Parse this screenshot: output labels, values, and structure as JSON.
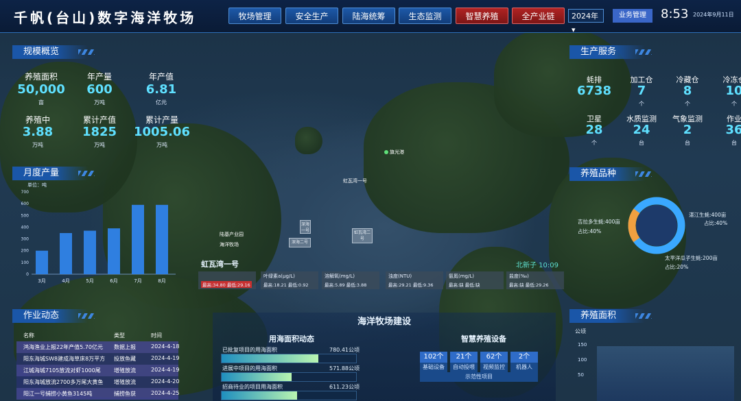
{
  "header": {
    "title": "千帆(台山)数字海洋牧场",
    "nav": [
      "牧场管理",
      "安全生产",
      "陆海统筹",
      "生态监测",
      "智慧养殖",
      "全产业链"
    ],
    "year": "2024年",
    "biz": "业务管理",
    "time": "8:53",
    "date": "2024年9月11日"
  },
  "scale": {
    "title": "规模概览",
    "items": [
      {
        "label": "养殖面积",
        "value": "50,000",
        "unit": "亩"
      },
      {
        "label": "年产量",
        "value": "600",
        "unit": "万吨"
      },
      {
        "label": "年产值",
        "value": "6.81",
        "unit": "亿元"
      },
      {
        "label": "养殖中",
        "value": "3.88",
        "unit": "万吨"
      },
      {
        "label": "累计产值",
        "value": "1825",
        "unit": "万吨"
      },
      {
        "label": "累计产量",
        "value": "1005.06",
        "unit": "万吨"
      }
    ]
  },
  "monthly": {
    "title": "月度产量",
    "ylabel": "单位：吨"
  },
  "chart_data": {
    "type": "bar",
    "categories": [
      "3月",
      "4月",
      "5月",
      "6月",
      "7月",
      "8月"
    ],
    "values": [
      200,
      350,
      370,
      390,
      590,
      590
    ],
    "yticks": [
      "0",
      "100",
      "200",
      "300",
      "400",
      "500",
      "600",
      "700"
    ],
    "ylim": [
      0,
      700
    ]
  },
  "activity": {
    "title": "作业动态",
    "headers": [
      "名称",
      "类型",
      "时间"
    ],
    "rows": [
      [
        "鸿海渔业上报22年产值5.70亿元",
        "数据上报",
        "2024-4-18"
      ],
      [
        "阳东海城SW8建成海草床8万平方",
        "投放鱼藏",
        "2024-4-19"
      ],
      [
        "江城海城7105放流对虾1000尾",
        "增殖放流",
        "2024-4-19"
      ],
      [
        "阳东海城放流2700多万尾大黄鱼",
        "增殖放流",
        "2024-4-20"
      ],
      [
        "阳江一号捕捞小黄鱼3145吨",
        "捕捞鱼获",
        "2024-4-25"
      ]
    ]
  },
  "production": {
    "title": "生产服务",
    "items": [
      {
        "label": "蚝排",
        "value": "6738",
        "unit": ""
      },
      {
        "label": "加工仓",
        "value": "7",
        "unit": "个"
      },
      {
        "label": "冷藏仓",
        "value": "8",
        "unit": "个"
      },
      {
        "label": "冷冻仓",
        "value": "10",
        "unit": "个"
      },
      {
        "label": "卫星",
        "value": "28",
        "unit": "个"
      },
      {
        "label": "水质监测",
        "value": "24",
        "unit": "台"
      },
      {
        "label": "气象监测",
        "value": "2",
        "unit": "台"
      },
      {
        "label": "作业",
        "value": "36",
        "unit": "台"
      }
    ]
  },
  "species": {
    "title": "养殖品种",
    "slices": [
      {
        "label": "湛江生蚝:400亩",
        "pct": "占比:40%",
        "value": 40,
        "color": "#3aa8ff"
      },
      {
        "label": "太平洋瓜子生蚝:200亩",
        "pct": "占比:20%",
        "value": 20,
        "color": "#f0a040"
      },
      {
        "label": "吉拉多生蚝:400亩",
        "pct": "占比:40%",
        "value": 40,
        "color": "#3aa8ff"
      }
    ]
  },
  "area": {
    "title": "养殖面积",
    "unit": "公顷",
    "yticks": [
      "150",
      "100",
      "50",
      "0"
    ]
  },
  "map": {
    "bay": "虹瓦湾一号",
    "tags": [
      "虹瓦湾一号",
      "陆基产业园",
      "海洋牧场",
      "深海一号",
      "深海二号",
      "虹瓦湾二号",
      "旗光港",
      "北新子 10:09"
    ],
    "stats": [
      {
        "title": "虹瓦湾一号",
        "sub": "最高:34.80 最低:29.16"
      },
      {
        "title": "叶绿素a(μg/L)",
        "sub": "最高:18.21 最低:0.92"
      },
      {
        "title": "溶解氧(mg/L)",
        "sub": "最高:5.89 最低:3.88"
      },
      {
        "title": "浊度(NTU)",
        "sub": "最高:29.21 最低:9.36"
      },
      {
        "title": "氨氮(mg/L)",
        "sub": "最高:缺 最低:缺"
      },
      {
        "title": "盐度(‰)",
        "sub": "最高:缺 最低:29.26"
      }
    ]
  },
  "construction": {
    "title": "海洋牧场建设",
    "usage_title": "用海面积动态",
    "usage": [
      {
        "label": "已批复项目的用海面积",
        "value": "780.41公顷",
        "frac": 0.72
      },
      {
        "label": "进展中项目的用海面积",
        "value": "571.88公顷",
        "frac": 0.52
      },
      {
        "label": "招商待业的项目用海面积",
        "value": "611.23公顷",
        "frac": 0.56
      }
    ],
    "devices_title": "智慧养殖设备",
    "devices": [
      {
        "count": "102个",
        "label": "基础设备"
      },
      {
        "count": "21个",
        "label": "自动投喂"
      },
      {
        "count": "62个",
        "label": "视频监控"
      },
      {
        "count": "2个",
        "label": "机器人"
      }
    ],
    "device_footer": "示范性项目"
  }
}
